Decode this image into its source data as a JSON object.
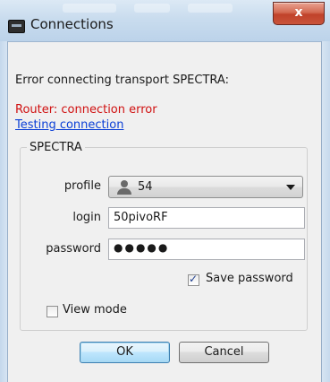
{
  "window": {
    "title": "Connections",
    "close_glyph": "x"
  },
  "messages": {
    "error": "Error connecting transport SPECTRA:",
    "router": "Router: connection error",
    "testing_link": "Testing connection"
  },
  "group": {
    "title": "SPECTRA",
    "profile_label": "profile",
    "profile_value": "54",
    "profile_icon": "user-icon",
    "login_label": "login",
    "login_value": "50pivoRF",
    "password_label": "password",
    "password_mask": "●●●●●",
    "save_password_label": "Save password",
    "save_password_checked": true
  },
  "view_mode": {
    "label": "View mode",
    "checked": false
  },
  "buttons": {
    "ok": "OK",
    "cancel": "Cancel"
  },
  "colors": {
    "error_red": "#d01010",
    "link_blue": "#0b3fd6",
    "close_red": "#c0412a"
  }
}
